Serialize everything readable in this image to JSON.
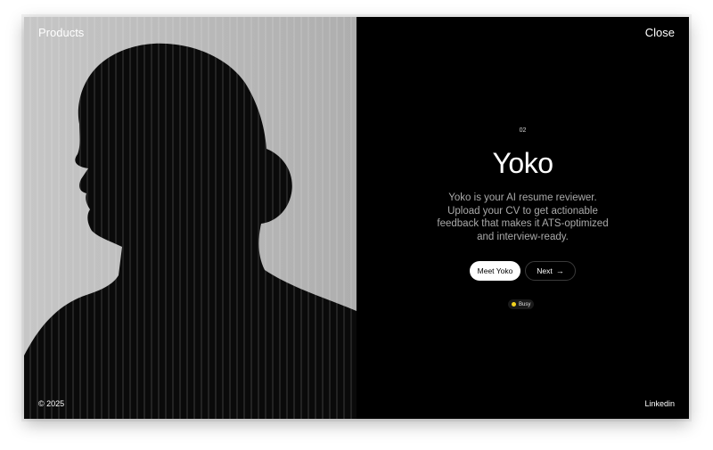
{
  "nav": {
    "products_label": "Products",
    "close_label": "Close"
  },
  "footer": {
    "copyright": "© 2025",
    "linkedin_label": "Linkedin"
  },
  "product": {
    "index": "02",
    "name": "Yoko",
    "description": "Yoko is your AI resume reviewer. Upload your CV to get actionable feedback that makes it ATS-optimized and interview-ready.",
    "primary_button": "Meet Yoko",
    "secondary_button": "Next",
    "next_arrow": "→",
    "status": {
      "label": "Busy",
      "color": "#f2d21e"
    }
  },
  "image": {
    "subject": "woman-silhouette-behind-ribbed-glass"
  },
  "colors": {
    "left_bg": "#b9b9b9",
    "right_bg": "#000000",
    "text": "#ffffff",
    "muted_text": "#a9a9a9"
  }
}
